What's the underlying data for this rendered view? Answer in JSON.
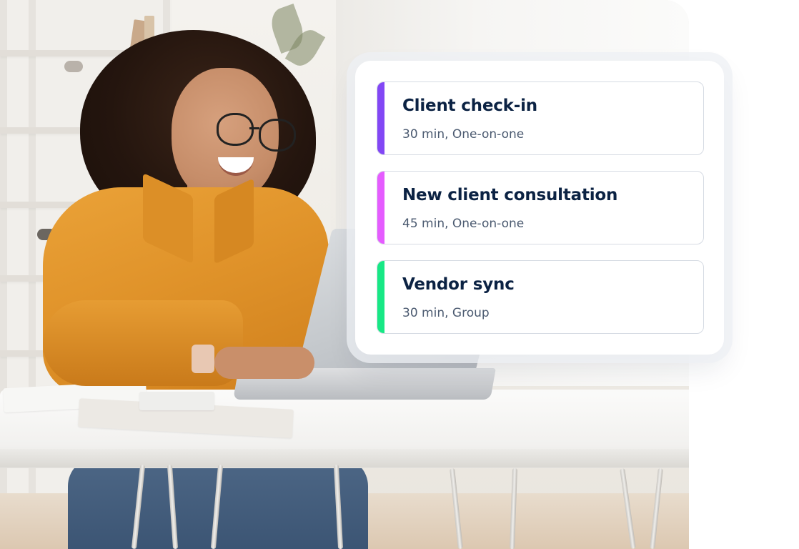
{
  "event_types": [
    {
      "title": "Client check-in",
      "meta": "30 min, One-on-one",
      "accent_color": "#8247f5"
    },
    {
      "title": "New client consultation",
      "meta": "45 min, One-on-one",
      "accent_color": "#e55cff"
    },
    {
      "title": "Vendor sync",
      "meta": "30 min, Group",
      "accent_color": "#17e885"
    }
  ],
  "colors": {
    "title_text": "#0b2243",
    "meta_text": "#4b5a70",
    "card_border": "#d6dbe3"
  }
}
